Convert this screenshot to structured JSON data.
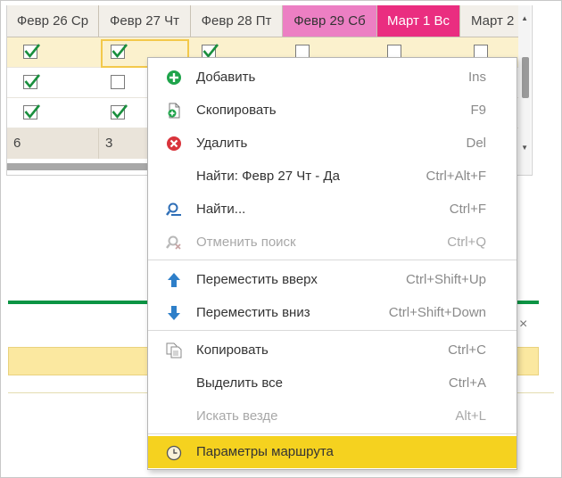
{
  "grid": {
    "columns": [
      "Февр 26 Ср",
      "Февр 27 Чт",
      "Февр 28 Пт",
      "Февр 29 Сб",
      "Март 1 Вс",
      "Март 2"
    ],
    "rows": [
      [
        true,
        true,
        true,
        false,
        false,
        false
      ],
      [
        true,
        false,
        null,
        null,
        null,
        null
      ],
      [
        true,
        true,
        null,
        null,
        null,
        null
      ]
    ],
    "totals": [
      "6",
      "3"
    ],
    "colors": {
      "saturday": "#ec7fc3",
      "sunday": "#ea2d80",
      "header": "#f2efe9",
      "selected_row": "#fbf1cd"
    }
  },
  "panel": {
    "close_glyph": "×",
    "accent_line": "#0b9444"
  },
  "menu": {
    "items": [
      {
        "label": "Добавить",
        "shortcut": "Ins",
        "icon": "add-icon",
        "enabled": true
      },
      {
        "label": "Скопировать",
        "shortcut": "F9",
        "icon": "copy-doc-icon",
        "enabled": true
      },
      {
        "label": "Удалить",
        "shortcut": "Del",
        "icon": "delete-icon",
        "enabled": true
      },
      {
        "label": "Найти: Февр 27 Чт - Да",
        "shortcut": "Ctrl+Alt+F",
        "icon": "",
        "enabled": true
      },
      {
        "label": "Найти...",
        "shortcut": "Ctrl+F",
        "icon": "search-icon",
        "enabled": true
      },
      {
        "label": "Отменить поиск",
        "shortcut": "Ctrl+Q",
        "icon": "cancel-search-icon",
        "enabled": false
      },
      {
        "label": "Переместить вверх",
        "shortcut": "Ctrl+Shift+Up",
        "icon": "arrow-up-icon",
        "enabled": true
      },
      {
        "label": "Переместить вниз",
        "shortcut": "Ctrl+Shift+Down",
        "icon": "arrow-down-icon",
        "enabled": true
      },
      {
        "label": "Копировать",
        "shortcut": "Ctrl+C",
        "icon": "clipboard-copy-icon",
        "enabled": true
      },
      {
        "label": "Выделить все",
        "shortcut": "Ctrl+A",
        "icon": "",
        "enabled": true
      },
      {
        "label": "Искать везде",
        "shortcut": "Alt+L",
        "icon": "",
        "enabled": false
      },
      {
        "label": "Параметры маршрута",
        "shortcut": "",
        "icon": "clock-icon",
        "enabled": true,
        "highlighted": true
      }
    ],
    "highlight_color": "#f5d21f"
  }
}
